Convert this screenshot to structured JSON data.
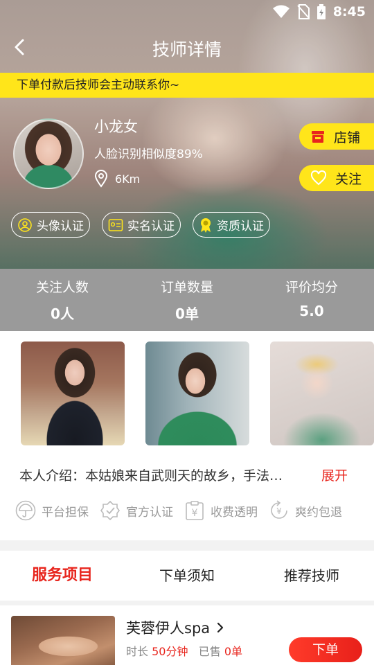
{
  "status": {
    "time": "8:45"
  },
  "nav": {
    "title": "技师详情"
  },
  "notice": "下单付款后技师会主动联系你~",
  "therapist": {
    "name": "小龙女",
    "face_similarity": "人脸识别相似度89%",
    "distance": "6Km"
  },
  "actions": {
    "shop": "店铺",
    "follow": "关注"
  },
  "badges": [
    "头像认证",
    "实名认证",
    "资质认证"
  ],
  "stats": [
    {
      "label": "关注人数",
      "value": "0人"
    },
    {
      "label": "订单数量",
      "value": "0单"
    },
    {
      "label": "评价均分",
      "value": "5.0"
    }
  ],
  "intro": {
    "text": "本人介绍：本姑娘来自武则天的故乡，手法…",
    "expand": "展开"
  },
  "guarantees": [
    "平台担保",
    "官方认证",
    "收费透明",
    "爽约包退"
  ],
  "tabs": [
    "服务项目",
    "下单须知",
    "推荐技师"
  ],
  "service": {
    "name": "芙蓉伊人spa",
    "duration_label": "时长",
    "duration": "50分钟",
    "sold_label": "已售",
    "sold": "0单",
    "order_button": "下单"
  },
  "colors": {
    "accent": "#e8251d",
    "highlight": "#ffe51a",
    "stats_bg": "#9a9a9a"
  }
}
